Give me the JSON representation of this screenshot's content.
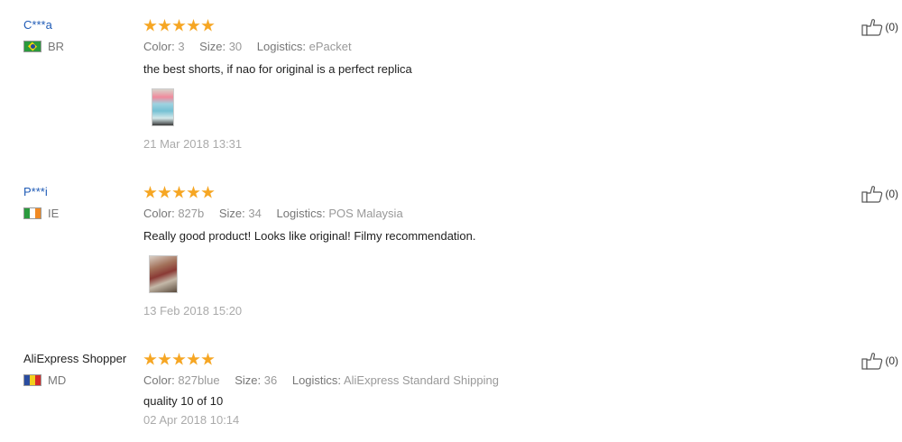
{
  "labels": {
    "color": "Color:",
    "size": "Size:",
    "logistics": "Logistics:"
  },
  "reviews": [
    {
      "user": "C***a",
      "country": "BR",
      "stars": 5,
      "color": "3",
      "size": "30",
      "logistics": "ePacket",
      "text": "the best shorts, if nao for original is a perfect replica",
      "has_image": true,
      "date": "21 Mar 2018 13:31",
      "helpful": "(0)"
    },
    {
      "user": "P***i",
      "country": "IE",
      "stars": 5,
      "color": "827b",
      "size": "34",
      "logistics": "POS Malaysia",
      "text": "Really good product! Looks like original! Filmy recommendation.",
      "has_image": true,
      "date": "13 Feb 2018 15:20",
      "helpful": "(0)"
    },
    {
      "user": "AliExpress Shopper",
      "country": "MD",
      "stars": 5,
      "color": "827blue",
      "size": "36",
      "logistics": "AliExpress Standard Shipping",
      "text": "quality 10 of 10",
      "has_image": false,
      "date": "02 Apr 2018 10:14",
      "helpful": "(0)"
    }
  ],
  "colors": {
    "star": "#f6a623",
    "username": "#1f5bb6"
  },
  "icons": [
    "thumbs-up-icon",
    "star-icon",
    "flag-icon"
  ]
}
